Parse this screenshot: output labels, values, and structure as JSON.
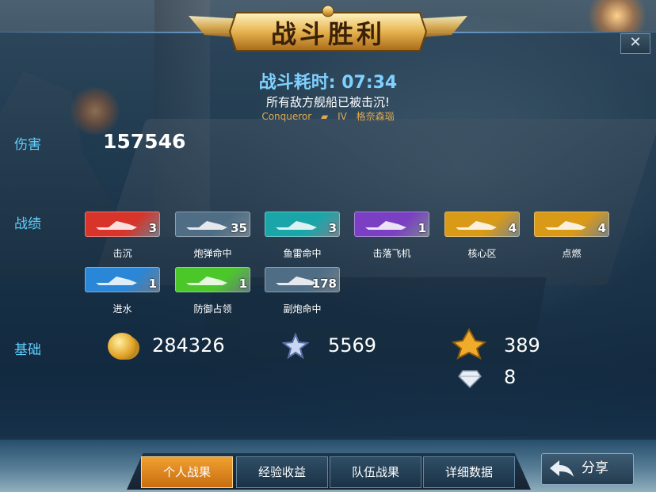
{
  "header": {
    "title": "战斗胜利",
    "duration": "战斗耗时: 07:34",
    "result_text": "所有敌方舰船已被击沉!",
    "ship_name": "Conqueror",
    "ship_tier": "IV",
    "ship_crew": "格奈森瑙",
    "close_label": "✕"
  },
  "damage": {
    "label": "伤害",
    "value": "157546"
  },
  "record": {
    "label": "战绩",
    "badges": [
      {
        "name": "击沉",
        "count": "3",
        "color": "#d8342a",
        "icon": "sinking-ship-icon"
      },
      {
        "name": "炮弹命中",
        "count": "35",
        "color": "#4f6e86",
        "icon": "shell-icon"
      },
      {
        "name": "鱼雷命中",
        "count": "3",
        "color": "#1aa6a8",
        "icon": "torpedo-icon"
      },
      {
        "name": "击落飞机",
        "count": "1",
        "color": "#7a3fc2",
        "icon": "plane-icon"
      },
      {
        "name": "核心区",
        "count": "4",
        "color": "#d99a17",
        "icon": "core-hit-icon"
      },
      {
        "name": "点燃",
        "count": "4",
        "color": "#d99a17",
        "icon": "fire-icon"
      },
      {
        "name": "进水",
        "count": "1",
        "color": "#2a86d6",
        "icon": "flooding-icon"
      },
      {
        "name": "防御占领",
        "count": "1",
        "color": "#4cc72a",
        "icon": "defense-capture-icon"
      },
      {
        "name": "副炮命中",
        "count": "178",
        "color": "#4f6e86",
        "icon": "secondary-gun-icon"
      }
    ]
  },
  "base": {
    "label": "基础",
    "coins": "284326",
    "exp": "5569",
    "captain_exp": "389",
    "diamonds": "8"
  },
  "tabs": [
    {
      "label": "个人战果",
      "active": true
    },
    {
      "label": "经验收益",
      "active": false
    },
    {
      "label": "队伍战果",
      "active": false
    },
    {
      "label": "详细数据",
      "active": false
    }
  ],
  "share_label": "分享"
}
